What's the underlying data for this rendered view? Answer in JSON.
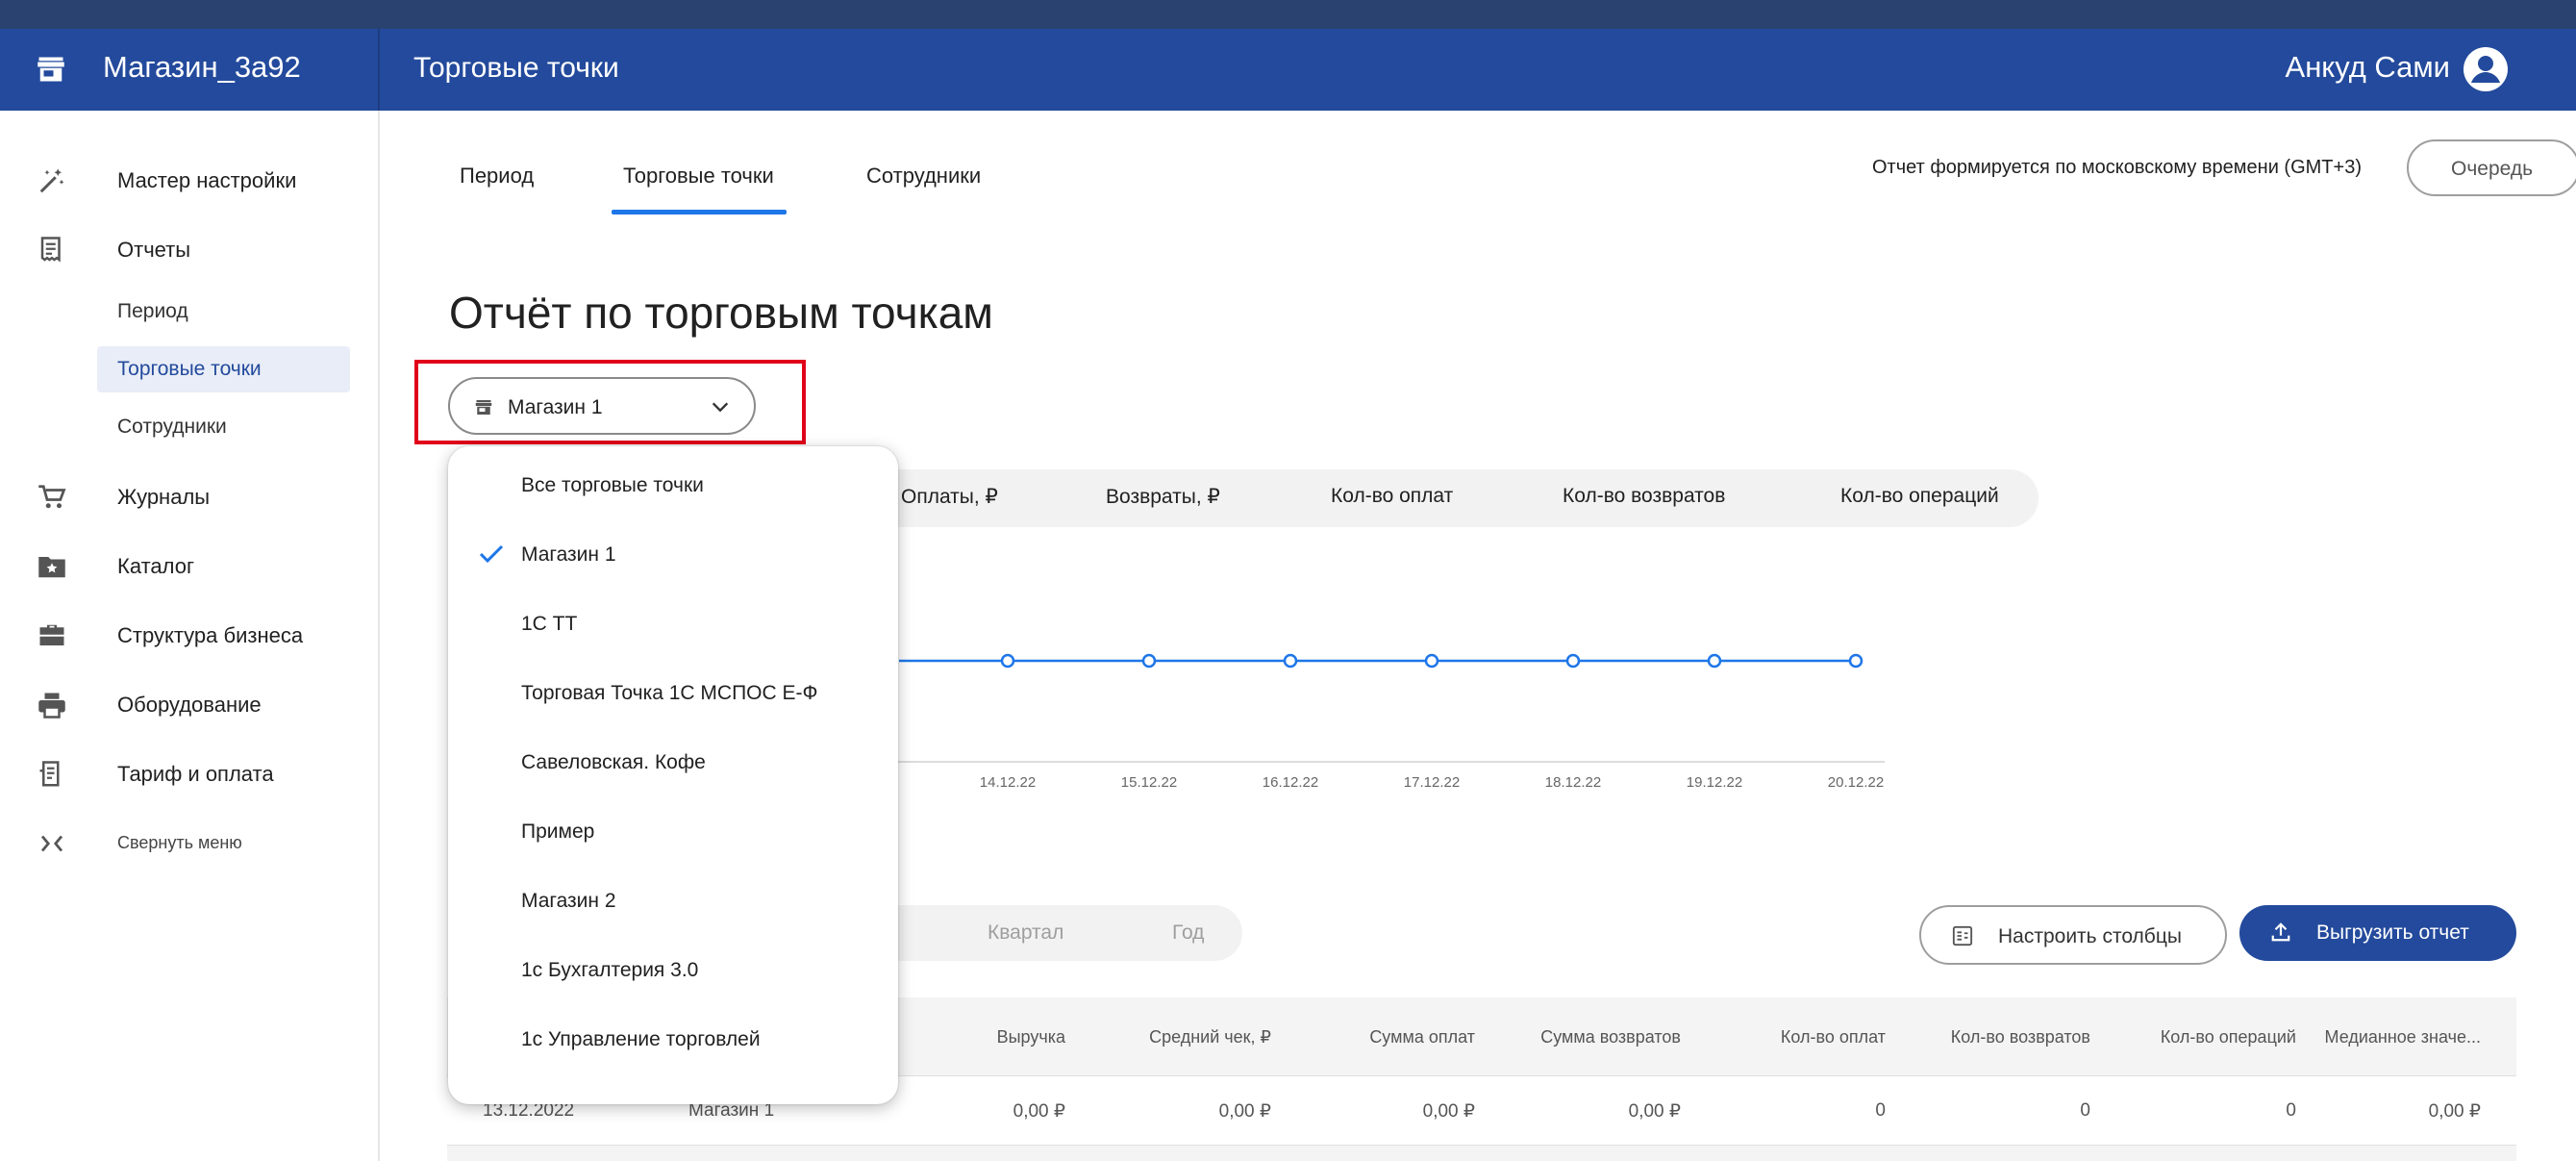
{
  "header": {
    "brand": "Магазин_3а92",
    "page_title": "Торговые точки",
    "user_name": "Анкуд Сами"
  },
  "sidebar": {
    "items": [
      {
        "label": "Мастер настройки",
        "icon": "magic-wand-icon"
      },
      {
        "label": "Отчеты",
        "icon": "receipt-icon"
      },
      {
        "label": "Журналы",
        "icon": "cart-icon"
      },
      {
        "label": "Каталог",
        "icon": "folder-star-icon"
      },
      {
        "label": "Структура бизнеса",
        "icon": "briefcase-icon"
      },
      {
        "label": "Оборудование",
        "icon": "printer-icon"
      },
      {
        "label": "Тариф и оплата",
        "icon": "invoice-icon"
      }
    ],
    "reports_sub": [
      "Период",
      "Торговые точки",
      "Сотрудники"
    ],
    "collapse_label": "Свернуть меню"
  },
  "tabs": [
    "Период",
    "Торговые точки",
    "Сотрудники"
  ],
  "timezone_note": "Отчет формируется по московскому времени (GMT+3)",
  "queue_label": "Очередь",
  "report_title": "Отчёт по торговым точкам",
  "store_select": {
    "value": "Магазин 1"
  },
  "metrics": [
    "Оплаты, ₽",
    "Возвраты, ₽",
    "Кол-во оплат",
    "Кол-во возвратов",
    "Кол-во операций"
  ],
  "chart_data": {
    "type": "line",
    "x": [
      "14.12.22",
      "15.12.22",
      "16.12.22",
      "17.12.22",
      "18.12.22",
      "19.12.22",
      "20.12.22"
    ],
    "series": [
      {
        "values": [
          0,
          0,
          0,
          0,
          0,
          0,
          0
        ]
      }
    ],
    "color": "#1e76e8",
    "grid": false
  },
  "periods": [
    "Квартал",
    "Год"
  ],
  "buttons": {
    "columns": "Настроить столбцы",
    "export": "Выгрузить отчет"
  },
  "table": {
    "headers": [
      "Выручка",
      "Средний чек, ₽",
      "Сумма оплат",
      "Сумма возвратов",
      "Кол-во оплат",
      "Кол-во возвратов",
      "Кол-во операций",
      "Медианное значе..."
    ],
    "row": {
      "date": "13.12.2022",
      "store": "Магазин 1",
      "values": [
        "0,00 ₽",
        "0,00 ₽",
        "0,00 ₽",
        "0,00 ₽",
        "0",
        "0",
        "0",
        "0,00 ₽"
      ]
    }
  },
  "dropdown": {
    "items": [
      "Все торговые точки",
      "Магазин 1",
      "1С ТТ",
      "Торговая Точка 1С МСПОС Е-Ф",
      "Савеловская. Кофе",
      "Пример",
      "Магазин 2",
      "1с Бухгалтерия 3.0",
      "1с Управление торговлей"
    ],
    "selected_index": 1
  },
  "colors": {
    "header": "#234a9c",
    "accent": "#1e76e8",
    "highlight": "#e0001a"
  }
}
